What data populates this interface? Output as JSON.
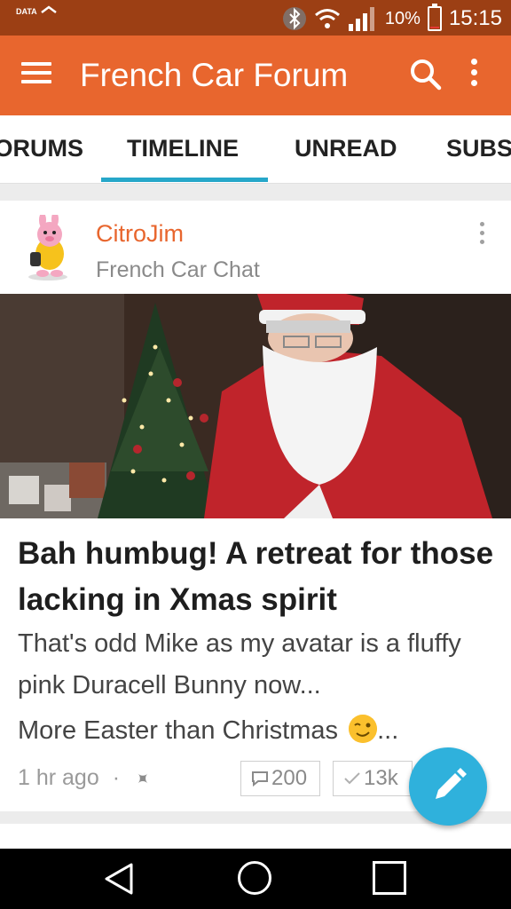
{
  "status_bar": {
    "data_indicator": "DATA",
    "battery_percent": "10%",
    "battery_level": 0.1,
    "time": "15:15",
    "icons": [
      "bluetooth-icon",
      "wifi-icon",
      "signal-icon",
      "battery-icon"
    ]
  },
  "app_bar": {
    "title": "French Car Forum",
    "icons": [
      "menu-icon",
      "search-icon",
      "more-vert-icon"
    ]
  },
  "tabs": {
    "items": [
      {
        "label": "FORUMS"
      },
      {
        "label": "TIMELINE"
      },
      {
        "label": "UNREAD"
      },
      {
        "label": "SUBS"
      }
    ],
    "active": "TIMELINE",
    "accent_color": "#26a7c9"
  },
  "post": {
    "author": "CitroJim",
    "forum": "French Car Chat",
    "title": "Bah humbug! A retreat for those lacking in Xmas spirit",
    "excerpt_line1": "That's odd Mike as my avatar is a fluffy pink Duracell Bunny now...",
    "excerpt_line2": "More Easter than Christmas",
    "excerpt_suffix": "...",
    "time": "1 hr ago",
    "separator": "·",
    "comments": "200",
    "views": "13k"
  },
  "colors": {
    "brand": "#e8662e",
    "status_bar": "#9c3f14",
    "fab": "#2fb1dc"
  }
}
